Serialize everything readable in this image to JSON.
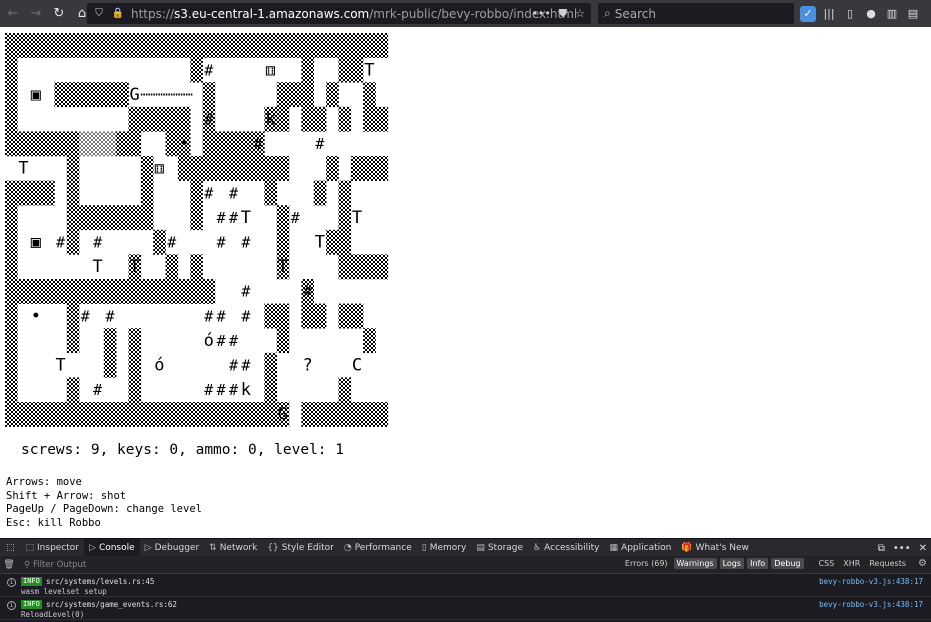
{
  "browser": {
    "url_prefix": "https://",
    "url_domain": "s3.eu-central-1.amazonaws.com",
    "url_path": "/mrk-public/bevy-robbo/index.html",
    "search_placeholder": "Search",
    "icons": [
      "back-icon",
      "forward-icon",
      "reload-icon",
      "home-icon",
      "shield-icon",
      "lock-icon",
      "more-icon",
      "pocket-icon",
      "bookmark-star-icon",
      "search-icon",
      "extension-icon",
      "library-icon",
      "sidebar-icon",
      "account-icon",
      "reader-icon",
      "menu-icon"
    ]
  },
  "game": {
    "grid_rows": [
      "WWWWWWWWWWWWWWWWWWWWWWWWWWWWWWW",
      "W..............W#...D...W..WW.TW",
      "W.B.WWWWWWG.....W.....WWW.W..W..W",
      "W.........WWWWW.W#...WWkWW.W.WWW",
      "WWWWWWSSSWW..WWoWWWWW.#.......#.W",
      "T....W.....W.DWWWWWWWWW...W.WWWWW",
      "WWWW.W.....W...W.#.#.W...W.W...W",
      "W....WWWWWWW...W..##T.W.#..W..T.W",
      "W.B.#W#.....W.#...#.#.W...WWT....W",
      "W.......T.WT.W.W......W.T..WWWW..WW",
      "WWWWWWWWWWWWWWWWW.....#.W...#.....W",
      "W.o..W.##........##.#WW.WW.WW..WW",
      "W....W..W.W.......o##.W......W...W",
      "W...T...W.W.o.....##.W...?...C..W",
      "W....W..#.W......###kW.....W....W",
      "WWWWWWWWWWWWWWWWWWWWWWWGWWWWWWWW"
    ],
    "legend": {
      "W": "wall",
      "S": "light-wall",
      "#": "screw",
      "D": "capsule-door",
      "B": "box",
      "G": "gun",
      "T": "tree",
      "k": "key",
      "o": "bullet",
      "?": "question",
      "C": "capsule"
    },
    "overlays": [
      {
        "ch": "#",
        "r": 1,
        "c": 16
      },
      {
        "ch": "⚅",
        "r": 1,
        "c": 21
      },
      {
        "ch": "T",
        "r": 1,
        "c": 29
      },
      {
        "ch": "▣",
        "r": 2,
        "c": 2
      },
      {
        "ch": "G",
        "r": 2,
        "c": 10
      },
      {
        "ch": "#",
        "r": 3,
        "c": 16
      },
      {
        "ch": "k",
        "r": 3,
        "c": 21
      },
      {
        "ch": "•",
        "r": 4,
        "c": 14
      },
      {
        "ch": "#",
        "r": 4,
        "c": 20
      },
      {
        "ch": "#",
        "r": 4,
        "c": 25
      },
      {
        "ch": "T",
        "r": 5,
        "c": 1
      },
      {
        "ch": "⚅",
        "r": 5,
        "c": 12
      },
      {
        "ch": "#",
        "r": 6,
        "c": 16
      },
      {
        "ch": "#",
        "r": 6,
        "c": 18
      },
      {
        "ch": "#",
        "r": 7,
        "c": 17
      },
      {
        "ch": "#",
        "r": 7,
        "c": 18
      },
      {
        "ch": "T",
        "r": 7,
        "c": 19
      },
      {
        "ch": "#",
        "r": 7,
        "c": 23
      },
      {
        "ch": "T",
        "r": 7,
        "c": 28
      },
      {
        "ch": "▣",
        "r": 8,
        "c": 2
      },
      {
        "ch": "#",
        "r": 8,
        "c": 4
      },
      {
        "ch": "#",
        "r": 8,
        "c": 7
      },
      {
        "ch": "#",
        "r": 8,
        "c": 13
      },
      {
        "ch": "#",
        "r": 8,
        "c": 17
      },
      {
        "ch": "#",
        "r": 8,
        "c": 19
      },
      {
        "ch": "T",
        "r": 8,
        "c": 25
      },
      {
        "ch": "T",
        "r": 9,
        "c": 7
      },
      {
        "ch": "T",
        "r": 9,
        "c": 10
      },
      {
        "ch": "T",
        "r": 9,
        "c": 22
      },
      {
        "ch": "#",
        "r": 10,
        "c": 19
      },
      {
        "ch": "#",
        "r": 10,
        "c": 24
      },
      {
        "ch": "•",
        "r": 11,
        "c": 2
      },
      {
        "ch": "#",
        "r": 11,
        "c": 6
      },
      {
        "ch": "#",
        "r": 11,
        "c": 8
      },
      {
        "ch": "#",
        "r": 11,
        "c": 16
      },
      {
        "ch": "#",
        "r": 11,
        "c": 17
      },
      {
        "ch": "#",
        "r": 11,
        "c": 19
      },
      {
        "ch": "ó",
        "r": 12,
        "c": 16
      },
      {
        "ch": "#",
        "r": 12,
        "c": 17
      },
      {
        "ch": "#",
        "r": 12,
        "c": 18
      },
      {
        "ch": "T",
        "r": 13,
        "c": 4
      },
      {
        "ch": "ó",
        "r": 13,
        "c": 12
      },
      {
        "ch": "#",
        "r": 13,
        "c": 18
      },
      {
        "ch": "#",
        "r": 13,
        "c": 19
      },
      {
        "ch": "?",
        "r": 13,
        "c": 24
      },
      {
        "ch": "C",
        "r": 13,
        "c": 28
      },
      {
        "ch": "#",
        "r": 14,
        "c": 7
      },
      {
        "ch": "#",
        "r": 14,
        "c": 16
      },
      {
        "ch": "#",
        "r": 14,
        "c": 17
      },
      {
        "ch": "#",
        "r": 14,
        "c": 18
      },
      {
        "ch": "k",
        "r": 14,
        "c": 19
      },
      {
        "ch": "G",
        "r": 15,
        "c": 22
      }
    ]
  },
  "status_line": "screws: 9, keys: 0, ammo: 0, level: 1",
  "help_lines": [
    "Arrows: move",
    "Shift + Arrow: shot",
    "PageUp / PageDown: change level",
    "Esc: kill Robbo"
  ],
  "devtools": {
    "tabs": [
      {
        "label": "Inspector",
        "icon": "inspector-icon",
        "glyph": "⬚"
      },
      {
        "label": "Console",
        "icon": "console-icon",
        "glyph": "▷",
        "active": true
      },
      {
        "label": "Debugger",
        "icon": "debugger-icon",
        "glyph": "▷"
      },
      {
        "label": "Network",
        "icon": "network-icon",
        "glyph": "⇅"
      },
      {
        "label": "Style Editor",
        "icon": "style-editor-icon",
        "glyph": "{}"
      },
      {
        "label": "Performance",
        "icon": "performance-icon",
        "glyph": "◔"
      },
      {
        "label": "Memory",
        "icon": "memory-icon",
        "glyph": "▯"
      },
      {
        "label": "Storage",
        "icon": "storage-icon",
        "glyph": "▤"
      },
      {
        "label": "Accessibility",
        "icon": "accessibility-icon",
        "glyph": "♿"
      },
      {
        "label": "Application",
        "icon": "application-icon",
        "glyph": "▦"
      },
      {
        "label": "What's New",
        "icon": "whats-new-icon",
        "glyph": "🎁"
      }
    ],
    "filter_placeholder": "Filter Output",
    "filters": [
      {
        "label": "Errors (69)",
        "on": false
      },
      {
        "label": "Warnings",
        "on": true
      },
      {
        "label": "Logs",
        "on": true
      },
      {
        "label": "Info",
        "on": true
      },
      {
        "label": "Debug",
        "on": true
      },
      {
        "label": "CSS",
        "on": false
      },
      {
        "label": "XHR",
        "on": false
      },
      {
        "label": "Requests",
        "on": false
      }
    ],
    "logs": [
      {
        "level": "INFO",
        "source": "src/systems/levels.rs:45",
        "message": "wasm levelset setup",
        "location": "bevy-robbo-v3.js:438:17"
      },
      {
        "level": "INFO",
        "source": "src/systems/game_events.rs:62",
        "message": "ReloadLevel(0)",
        "location": "bevy-robbo-v3.js:438:17"
      }
    ]
  },
  "colors": {
    "chrome": "#38383d",
    "devtools": "#2a2a2e",
    "console_bg": "#1c1b22",
    "info_badge": "#2a8a2a",
    "link": "#75bfff"
  }
}
